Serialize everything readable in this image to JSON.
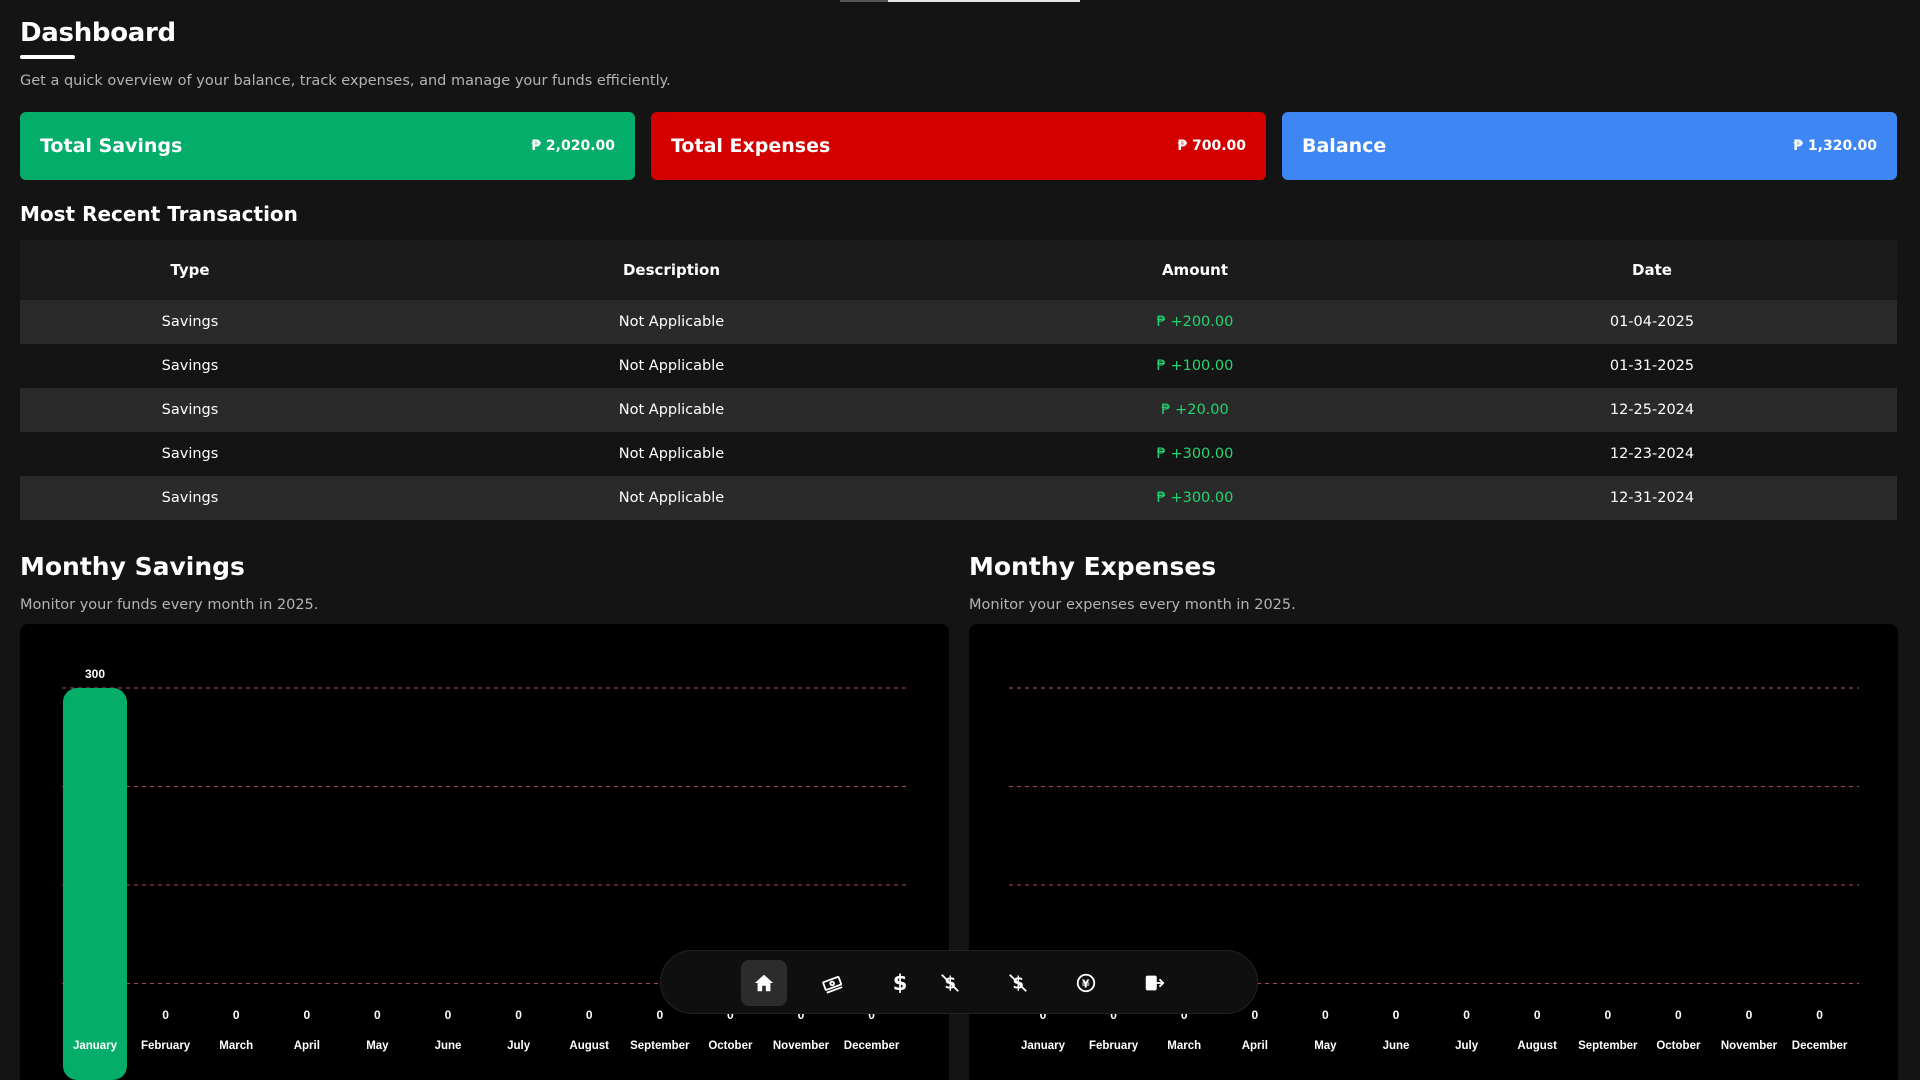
{
  "header": {
    "title": "Dashboard",
    "subtitle": "Get a quick overview of your balance, track expenses, and manage your funds efficiently."
  },
  "cards": {
    "savings": {
      "label": "Total Savings",
      "value": "₱ 2,020.00",
      "color": "#05ad6b"
    },
    "expenses": {
      "label": "Total Expenses",
      "value": "₱ 700.00",
      "color": "#d40000"
    },
    "balance": {
      "label": "Balance",
      "value": "₱ 1,320.00",
      "color": "#3d86f4"
    }
  },
  "transactions": {
    "title": "Most Recent Transaction",
    "headers": [
      "Type",
      "Description",
      "Amount",
      "Date"
    ],
    "rows": [
      [
        "Savings",
        "Not Applicable",
        "₱ +200.00",
        "01-04-2025"
      ],
      [
        "Savings",
        "Not Applicable",
        "₱ +100.00",
        "01-31-2025"
      ],
      [
        "Savings",
        "Not Applicable",
        "₱ +20.00",
        "12-25-2024"
      ],
      [
        "Savings",
        "Not Applicable",
        "₱ +300.00",
        "12-23-2024"
      ],
      [
        "Savings",
        "Not Applicable",
        "₱ +300.00",
        "12-31-2024"
      ]
    ]
  },
  "savings_chart": {
    "title": "Monthy Savings",
    "subtitle": "Monitor your funds every month in 2025."
  },
  "expenses_chart": {
    "title": "Monthy Expenses",
    "subtitle": "Monitor your expenses every month in 2025."
  },
  "chart_data": [
    {
      "type": "bar",
      "categories": [
        "January",
        "February",
        "March",
        "April",
        "May",
        "June",
        "July",
        "August",
        "September",
        "October",
        "November",
        "December"
      ],
      "values": [
        300,
        0,
        0,
        0,
        0,
        0,
        0,
        0,
        0,
        0,
        0,
        0
      ],
      "title": "Monthy Savings",
      "ylim": [
        0,
        300
      ],
      "grid": true,
      "bar_color": "#05ad6b",
      "grid_color": "#a8437a"
    },
    {
      "type": "bar",
      "categories": [
        "January",
        "February",
        "March",
        "April",
        "May",
        "June",
        "July",
        "August",
        "September",
        "October",
        "November",
        "December"
      ],
      "values": [
        0,
        0,
        0,
        0,
        0,
        0,
        0,
        0,
        0,
        0,
        0,
        0
      ],
      "title": "Monthy Expenses",
      "ylim": [
        0,
        300
      ],
      "grid": true,
      "bar_color": "#d40000",
      "grid_color": "#a8437a"
    }
  ],
  "dock": {
    "items": [
      {
        "name": "home-icon",
        "glyph": "⌂",
        "active": true
      },
      {
        "name": "money-stack-icon",
        "glyph": "💸",
        "active": false
      },
      {
        "name": "dollar-icon",
        "glyph": "$",
        "active": false
      },
      {
        "name": "dollar-off-icon",
        "glyph": "$̸",
        "active": false
      },
      {
        "name": "dollar-slash-icon",
        "glyph": "$̸",
        "active": false
      },
      {
        "name": "currency-exchange-icon",
        "glyph": "¥",
        "active": false
      },
      {
        "name": "logout-icon",
        "glyph": "⇥",
        "active": false
      }
    ]
  }
}
